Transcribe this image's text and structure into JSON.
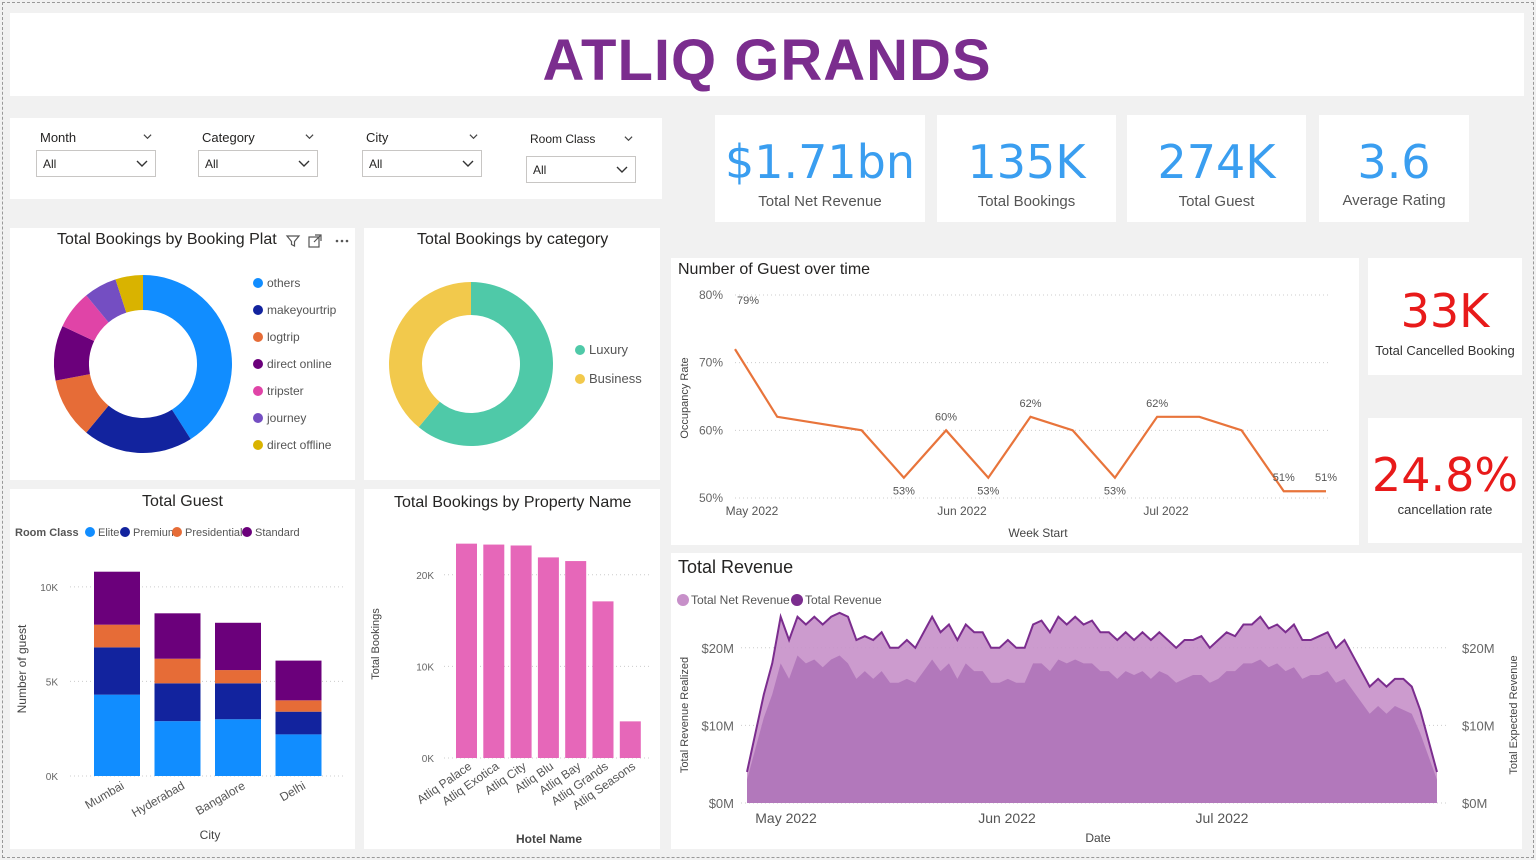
{
  "app_title": "ATLIQ GRANDS",
  "filters": [
    {
      "label": "Month",
      "value": "All"
    },
    {
      "label": "Category",
      "value": "All"
    },
    {
      "label": "City",
      "value": "All"
    },
    {
      "label": "Room Class",
      "value": "All"
    }
  ],
  "kpis": [
    {
      "value": "$1.71bn",
      "label": "Total Net Revenue"
    },
    {
      "value": "135K",
      "label": "Total Bookings"
    },
    {
      "value": "274K",
      "label": "Total Guest"
    },
    {
      "value": "3.6",
      "label": "Average Rating"
    }
  ],
  "kpis_side": [
    {
      "value": "33K",
      "label": "Total Cancelled Booking"
    },
    {
      "value": "24.8%",
      "label": "cancellation rate"
    }
  ],
  "colors": {
    "title": "#7b2d8e",
    "kpi_blue": "#3a9ef0",
    "kpi_red": "#e81a1a",
    "line": "#e8743b",
    "bar_pink": "#e667b9",
    "net_rev": "#c790c9",
    "total_rev": "#7b2d8e"
  },
  "chart_data": [
    {
      "id": "platform",
      "type": "pie",
      "title": "Total Bookings by Booking Plat",
      "legend_position": "right",
      "slices": [
        {
          "name": "others",
          "value": 41,
          "color": "#118dff"
        },
        {
          "name": "makeyourtrip",
          "value": 20,
          "color": "#12239e"
        },
        {
          "name": "logtrip",
          "value": 11,
          "color": "#e66c37"
        },
        {
          "name": "direct online",
          "value": 10,
          "color": "#6b007b"
        },
        {
          "name": "tripster",
          "value": 7,
          "color": "#e044a7"
        },
        {
          "name": "journey",
          "value": 6,
          "color": "#744ec2"
        },
        {
          "name": "direct offline",
          "value": 5,
          "color": "#d9b300"
        }
      ]
    },
    {
      "id": "category",
      "type": "pie",
      "title": "Total Bookings by category",
      "legend_position": "right",
      "slices": [
        {
          "name": "Luxury",
          "value": 61,
          "color": "#4fc9a8"
        },
        {
          "name": "Business",
          "value": 39,
          "color": "#f2c94c"
        }
      ]
    },
    {
      "id": "guest",
      "type": "bar",
      "stacked": true,
      "title": "Total Guest",
      "legend_title": "Room Class",
      "categories": [
        "Mumbai",
        "Hyderabad",
        "Bangalore",
        "Delhi"
      ],
      "series": [
        {
          "name": "Elite",
          "color": "#118dff",
          "values": [
            4300,
            2900,
            3000,
            2200
          ]
        },
        {
          "name": "Premium",
          "color": "#12239e",
          "values": [
            2500,
            2000,
            1900,
            1200
          ]
        },
        {
          "name": "Presidential",
          "color": "#e66c37",
          "values": [
            1200,
            1300,
            700,
            600
          ]
        },
        {
          "name": "Standard",
          "color": "#6b007b",
          "values": [
            2800,
            2400,
            2500,
            2100
          ]
        }
      ],
      "xlabel": "City",
      "ylabel": "Number of guest",
      "yticks": [
        "0K",
        "5K",
        "10K"
      ],
      "ylim": [
        0,
        12000
      ]
    },
    {
      "id": "property",
      "type": "bar",
      "title": "Total Bookings by Property Name",
      "categories": [
        "Atliq Palace",
        "Atliq Exotica",
        "Atliq City",
        "Atliq Blu",
        "Atliq Bay",
        "Atliq Grands",
        "Atliq Seasons"
      ],
      "values": [
        23400,
        23300,
        23200,
        21900,
        21500,
        17100,
        4000
      ],
      "xlabel": "Hotel Name",
      "ylabel": "Total Bookings",
      "yticks": [
        "0K",
        "10K",
        "20K"
      ],
      "ylim": [
        0,
        25000
      ]
    },
    {
      "id": "occupancy",
      "type": "line",
      "title": "Number of Guest over time",
      "xlabel": "Week Start",
      "ylabel": "Occupancy Rate",
      "yticks": [
        "50%",
        "60%",
        "70%",
        "80%"
      ],
      "ylim": [
        50,
        80
      ],
      "xticks": [
        "May 2022",
        "Jun 2022",
        "Jul 2022"
      ],
      "values": [
        72,
        62,
        61,
        60,
        53,
        60,
        53,
        62,
        60,
        53,
        62,
        62,
        60,
        51,
        51
      ],
      "data_labels": [
        "79%",
        "",
        "",
        "",
        "53%",
        "60%",
        "53%",
        "62%",
        "",
        "53%",
        "62%",
        "",
        "",
        "51%",
        "51%"
      ]
    },
    {
      "id": "revenue",
      "type": "area",
      "title": "Total Revenue",
      "series_names": [
        "Total Net Revenue",
        "Total Revenue"
      ],
      "xlabel": "Date",
      "ylabel_left": "Total Revenue Realized",
      "ylabel_right": "Total Expected Revenue",
      "yticks": [
        "$0M",
        "$10M",
        "$20M"
      ],
      "ylim": [
        0,
        25
      ],
      "xticks": [
        "May 2022",
        "Jun 2022",
        "Jul 2022"
      ],
      "total_revenue": [
        4,
        9,
        14,
        18,
        24,
        21,
        24,
        23,
        24,
        23,
        24,
        24.5,
        24,
        21,
        21.5,
        21,
        22,
        20,
        20,
        21,
        20,
        22,
        24,
        22,
        23,
        21,
        23,
        22,
        22,
        20,
        20,
        21,
        20,
        20,
        23,
        23.5,
        22,
        24,
        23,
        24,
        23,
        23.5,
        22,
        22,
        21,
        22,
        21,
        22,
        21,
        22,
        21,
        20,
        21,
        21,
        21.5,
        20,
        21,
        22,
        21.5,
        23,
        23,
        24,
        22.5,
        23,
        22,
        23,
        21,
        21,
        21.5,
        22,
        20,
        21,
        19,
        17,
        15,
        16,
        15,
        16,
        16,
        15,
        12,
        8,
        4
      ],
      "net_revenue": [
        3,
        7,
        11,
        14,
        18,
        16,
        19,
        18,
        18.5,
        17.5,
        18.5,
        19,
        18,
        16,
        17,
        16,
        17,
        15.5,
        15.5,
        16,
        15.5,
        17,
        18.5,
        17,
        18,
        16,
        18,
        17,
        17,
        15.5,
        15.5,
        16,
        15.5,
        15.5,
        18,
        18,
        17,
        18.5,
        18,
        18.5,
        18,
        18,
        17,
        17,
        16,
        17,
        16.5,
        17,
        16,
        17,
        16.5,
        15.5,
        16,
        16.5,
        16.5,
        15.5,
        16,
        17,
        17,
        18,
        18,
        18.5,
        17.5,
        18,
        17,
        17.5,
        16,
        16.5,
        16.5,
        17,
        15.5,
        16,
        14.5,
        13,
        11.5,
        12.5,
        11.5,
        12.5,
        12,
        11.5,
        9,
        6,
        3
      ]
    }
  ]
}
